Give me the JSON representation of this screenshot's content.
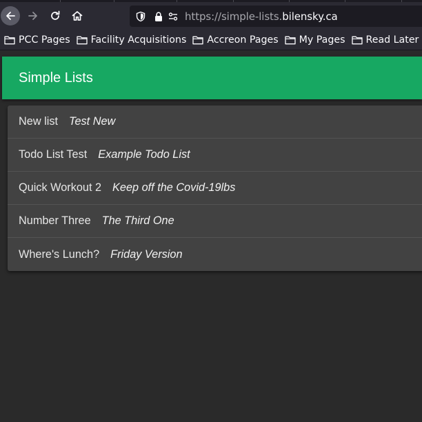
{
  "browser": {
    "url_scheme_prefix": "https://simple-lists.",
    "url_host": "bilensky.ca",
    "nav_icons": [
      "back-arrow-icon",
      "forward-arrow-icon",
      "reload-icon",
      "home-icon"
    ],
    "urlbar_icons": [
      "shield-icon",
      "lock-icon",
      "permissions-icon"
    ]
  },
  "bookmarks": [
    {
      "label": "PCC Pages",
      "icon": "folder-icon"
    },
    {
      "label": "Facility Acquisitions",
      "icon": "folder-icon"
    },
    {
      "label": "Accreon Pages",
      "icon": "folder-icon"
    },
    {
      "label": "My Pages",
      "icon": "folder-icon"
    },
    {
      "label": "Read Later",
      "icon": "folder-icon"
    }
  ],
  "app": {
    "title": "Simple Lists",
    "header_color": "#17a862"
  },
  "lists": [
    {
      "name": "New list",
      "description": "Test New"
    },
    {
      "name": "Todo List Test",
      "description": "Example Todo List"
    },
    {
      "name": "Quick Workout 2",
      "description": "Keep off the Covid-19lbs"
    },
    {
      "name": "Number Three",
      "description": "The Third One"
    },
    {
      "name": "Where's Lunch?",
      "description": "Friday Version"
    }
  ]
}
